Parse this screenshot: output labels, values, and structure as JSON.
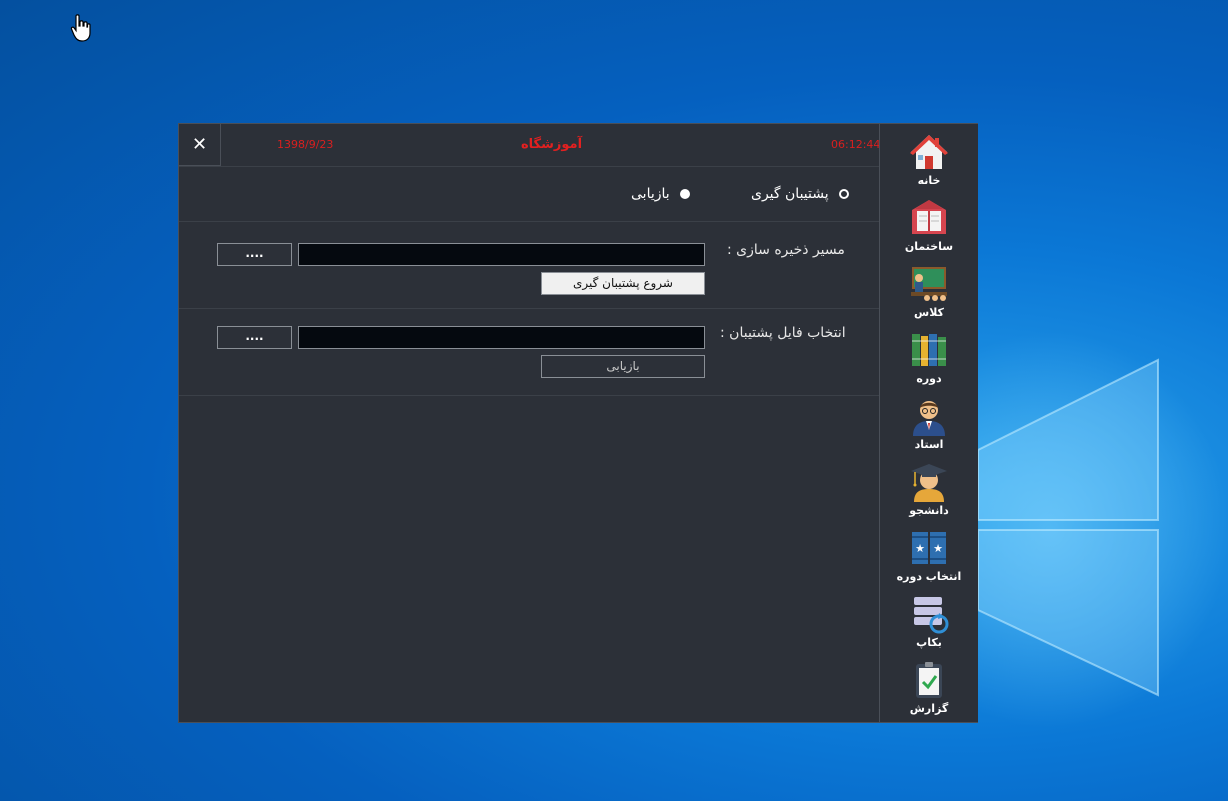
{
  "window": {
    "close_label": "✕",
    "date": "1398/9/23",
    "title": "آموزشگاه",
    "time": "06:12:44"
  },
  "mode": {
    "backup_label": "پشتیبان گیری",
    "restore_label": "بازیابی",
    "selected": "backup"
  },
  "backup": {
    "label": "مسیر ذخیره سازی  :",
    "path_value": "",
    "browse_label": "....",
    "start_label": "شروع پشتیبان گیری"
  },
  "restore": {
    "label": "انتخاب فایل پشتیبان  :",
    "path_value": "",
    "browse_label": "....",
    "restore_label": "بازیابی"
  },
  "sidebar": {
    "items": [
      {
        "label": "خانه",
        "icon": "home-icon"
      },
      {
        "label": "ساختمان",
        "icon": "building-icon"
      },
      {
        "label": "کلاس",
        "icon": "classroom-icon"
      },
      {
        "label": "دوره",
        "icon": "books-icon"
      },
      {
        "label": "استاد",
        "icon": "teacher-icon"
      },
      {
        "label": "دانشجو",
        "icon": "student-icon"
      },
      {
        "label": "انتخاب دوره",
        "icon": "course-select-icon"
      },
      {
        "label": "بکاپ",
        "icon": "backup-icon"
      },
      {
        "label": "گزارش",
        "icon": "report-icon"
      }
    ]
  },
  "colors": {
    "panel": "#2c3038",
    "title_red": "#e32020",
    "input_bg": "#05090f"
  }
}
